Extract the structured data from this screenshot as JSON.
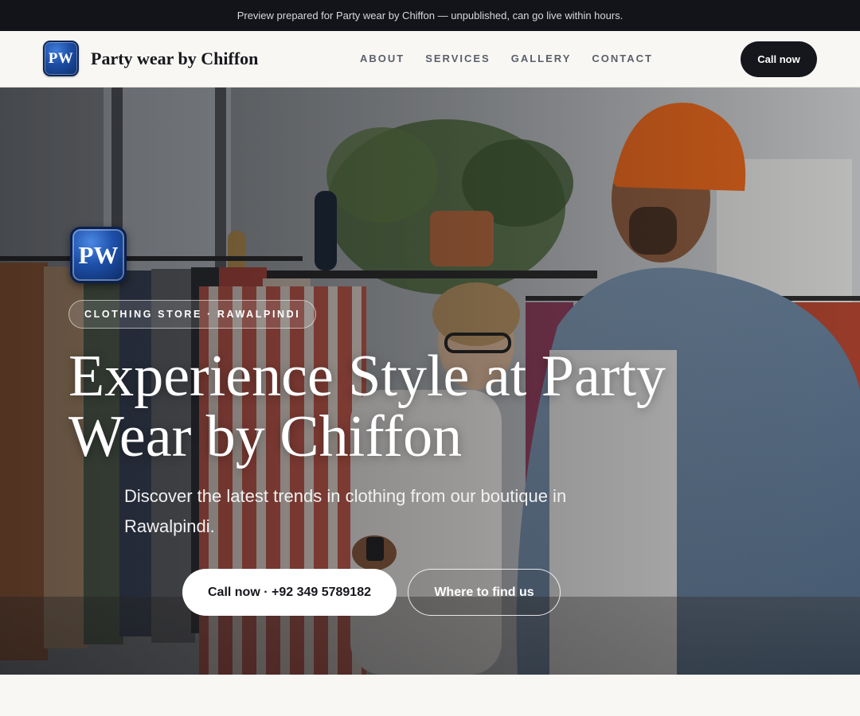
{
  "preview_notice": "Preview prepared for Party wear by Chiffon — unpublished, can go live within hours.",
  "header": {
    "logo_text": "PW",
    "brand_name": "Party wear by Chiffon",
    "nav": [
      "ABOUT",
      "SERVICES",
      "GALLERY",
      "CONTACT"
    ],
    "cta_label": "Call now"
  },
  "hero": {
    "logo_text": "PW",
    "eyebrow": "CLOTHING STORE · RAWALPINDI",
    "title": "Experience Style at Party Wear by Chiffon",
    "subtitle": "Discover the latest trends in clothing from our boutique in Rawalpindi.",
    "primary_cta": "Call now · +92 349 5789182",
    "secondary_cta": "Where to find us",
    "photo_icon": "clothing-store-photo"
  },
  "colors": {
    "dark": "#15171c",
    "logo_blue": "#1c4da3",
    "page_bg": "#f8f7f4",
    "beanie_orange": "#e4651b"
  }
}
